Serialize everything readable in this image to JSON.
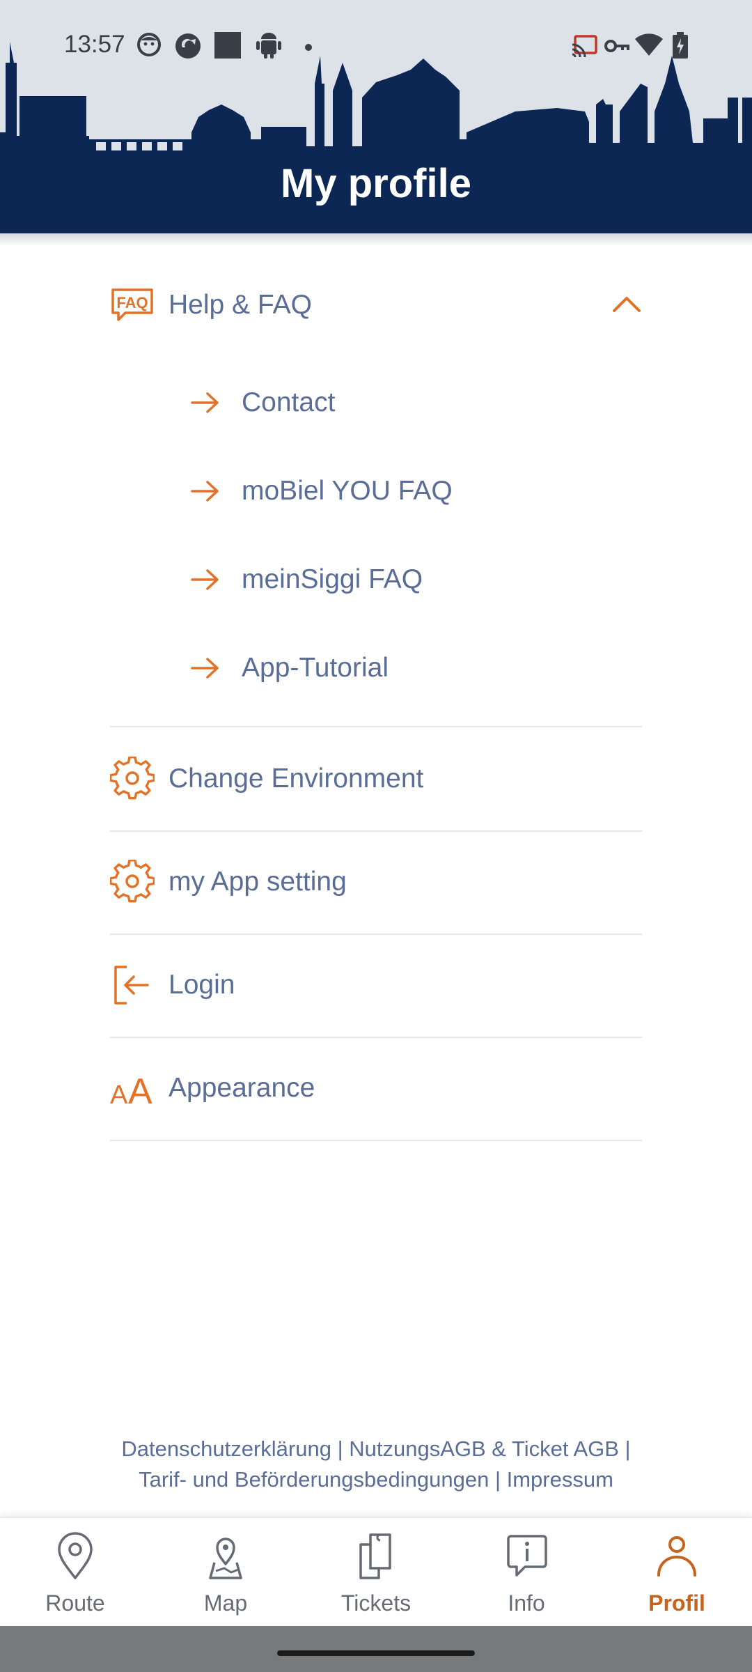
{
  "status_bar": {
    "time": "13:57"
  },
  "header": {
    "title": "My profile"
  },
  "menu": {
    "help_faq": {
      "label": "Help & FAQ",
      "icon": "faq-icon",
      "expanded": true,
      "sub_items": [
        {
          "label": "Contact"
        },
        {
          "label": "moBiel YOU FAQ"
        },
        {
          "label": "meinSiggi FAQ"
        },
        {
          "label": "App-Tutorial"
        }
      ]
    },
    "items": [
      {
        "label": "Change Environment",
        "icon": "gear-icon"
      },
      {
        "label": "my App setting",
        "icon": "gear-icon"
      },
      {
        "label": "Login",
        "icon": "login-icon"
      },
      {
        "label": "Appearance",
        "icon": "text-size-icon"
      }
    ]
  },
  "footer": {
    "line1": "Datenschutzerklärung | NutzungsAGB & Ticket AGB |",
    "line2": "Tarif- und Beförderungsbedingungen | Impressum"
  },
  "bottom_nav": {
    "items": [
      {
        "label": "Route",
        "icon": "location-pin-icon",
        "active": false
      },
      {
        "label": "Map",
        "icon": "map-pin-icon",
        "active": false
      },
      {
        "label": "Tickets",
        "icon": "ticket-icon",
        "active": false
      },
      {
        "label": "Info",
        "icon": "info-bubble-icon",
        "active": false
      },
      {
        "label": "Profil",
        "icon": "user-icon",
        "active": true
      }
    ]
  },
  "colors": {
    "navy": "#0d2754",
    "accent_orange": "#e27227",
    "text_blue": "#5a6d96",
    "active_nav": "#c8631d"
  }
}
